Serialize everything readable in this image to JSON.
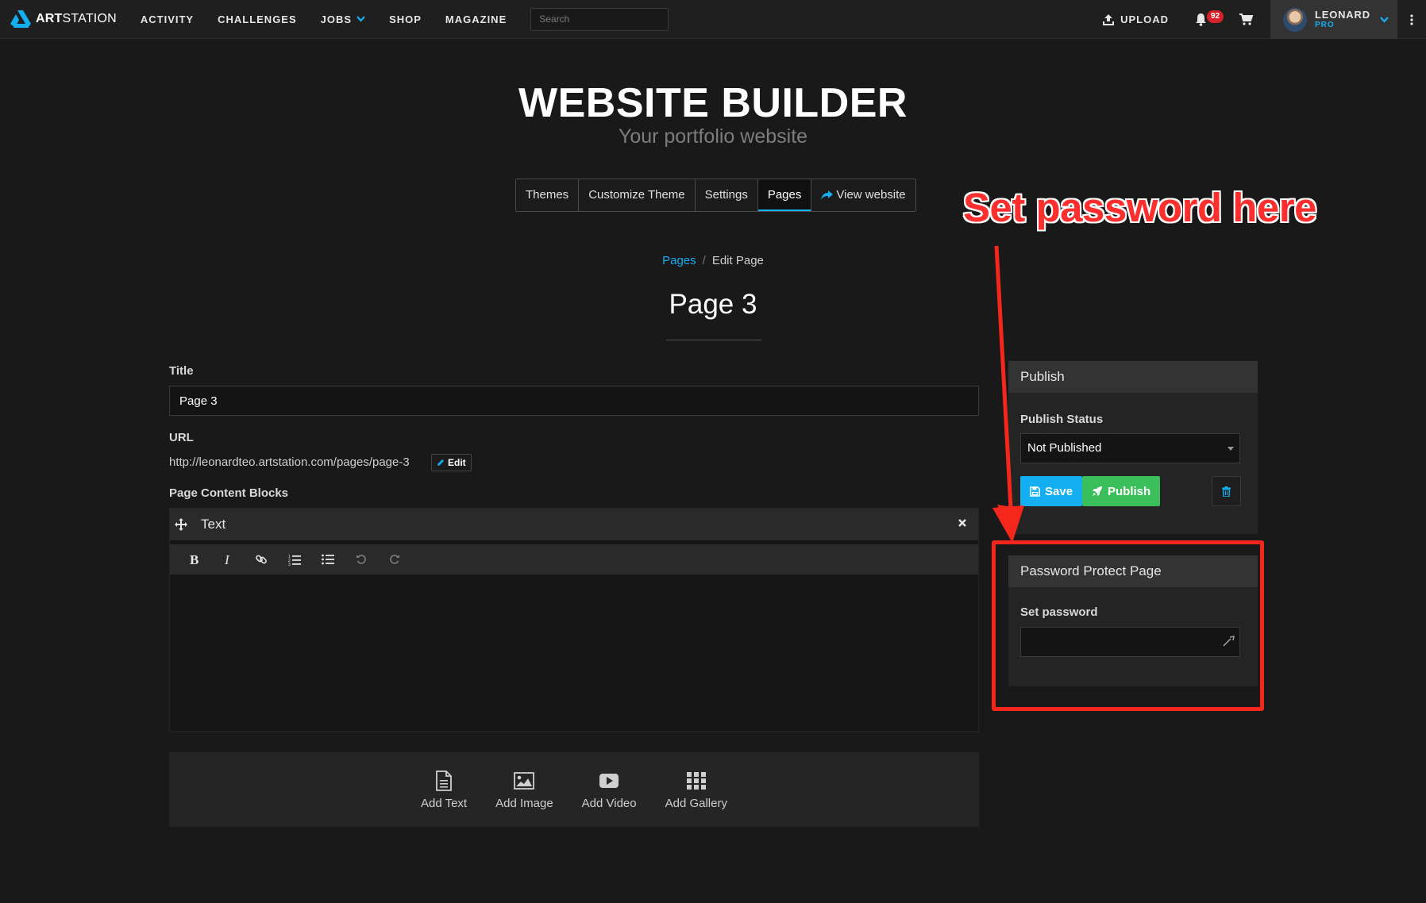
{
  "nav": {
    "brand_a": "ART",
    "brand_b": "STATION",
    "items": [
      "ACTIVITY",
      "CHALLENGES",
      "JOBS",
      "SHOP",
      "MAGAZINE"
    ],
    "search_placeholder": "Search",
    "upload": "UPLOAD",
    "notifications": "92",
    "user_name": "LEONARD",
    "user_tier": "PRO",
    "accent": "#13aff0"
  },
  "hero": {
    "title": "WEBSITE BUILDER",
    "subtitle": "Your portfolio website"
  },
  "tabs": {
    "items": [
      "Themes",
      "Customize Theme",
      "Settings",
      "Pages",
      "View website"
    ],
    "active": "Pages"
  },
  "breadcrumb": {
    "parent": "Pages",
    "sep": "/",
    "current": "Edit Page"
  },
  "page": {
    "heading": "Page 3",
    "title_label": "Title",
    "title_value": "Page 3",
    "url_label": "URL",
    "url_value": "http://leonardteo.artstation.com/pages/page-3",
    "url_edit": "Edit",
    "blocks_label": "Page Content Blocks",
    "block_type": "Text"
  },
  "add_bar": {
    "items": [
      "Add Text",
      "Add Image",
      "Add Video",
      "Add Gallery"
    ]
  },
  "publish": {
    "header": "Publish",
    "status_label": "Publish Status",
    "status_value": "Not Published",
    "save": "Save",
    "publish": "Publish",
    "save_color": "#13aff0",
    "publish_color": "#3bbf5a"
  },
  "password": {
    "header": "Password Protect Page",
    "label": "Set password",
    "value": ""
  },
  "annotation": {
    "text": "Set password here",
    "color": "#f5271c"
  }
}
